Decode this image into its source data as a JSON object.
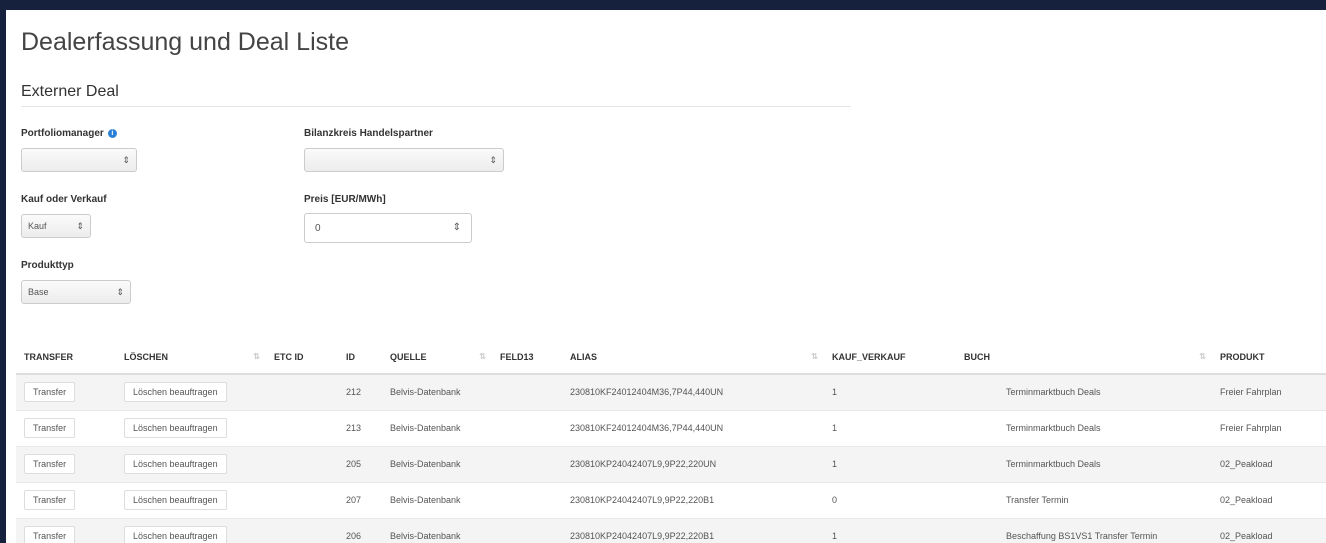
{
  "page": {
    "title": "Dealerfassung und Deal Liste",
    "section_title": "Externer Deal"
  },
  "form": {
    "portfoliomanager": {
      "label": "Portfoliomanager",
      "value": "",
      "info_icon": "info-icon"
    },
    "bilanzkreis": {
      "label": "Bilanzkreis Handelspartner",
      "value": ""
    },
    "kauf_verkauf": {
      "label": "Kauf oder Verkauf",
      "value": "Kauf"
    },
    "preis": {
      "label": "Preis [EUR/MWh]",
      "value": "0"
    },
    "produkttyp": {
      "label": "Produkttyp",
      "value": "Base"
    }
  },
  "table": {
    "columns": [
      "TRANSFER",
      "LÖSCHEN",
      "ETC ID",
      "ID",
      "QUELLE",
      "FELD13",
      "ALIAS",
      "KAUF_VERKAUF",
      "BUCH",
      "PRODUKT"
    ],
    "rows": [
      {
        "transfer": "Transfer",
        "loeschen": "Löschen beauftragen",
        "etc_id": "",
        "id": "212",
        "quelle": "Belvis-Datenbank",
        "feld13": "",
        "alias": "230810KF24012404M36,7P44,440UN",
        "kauf_verkauf": "1",
        "buch": "Terminmarktbuch Deals",
        "produkt": "Freier Fahrplan"
      },
      {
        "transfer": "Transfer",
        "loeschen": "Löschen beauftragen",
        "etc_id": "",
        "id": "213",
        "quelle": "Belvis-Datenbank",
        "feld13": "",
        "alias": "230810KF24012404M36,7P44,440UN",
        "kauf_verkauf": "1",
        "buch": "Terminmarktbuch Deals",
        "produkt": "Freier Fahrplan"
      },
      {
        "transfer": "Transfer",
        "loeschen": "Löschen beauftragen",
        "etc_id": "",
        "id": "205",
        "quelle": "Belvis-Datenbank",
        "feld13": "",
        "alias": "230810KP24042407L9,9P22,220UN",
        "kauf_verkauf": "1",
        "buch": "Terminmarktbuch Deals",
        "produkt": "02_Peakload"
      },
      {
        "transfer": "Transfer",
        "loeschen": "Löschen beauftragen",
        "etc_id": "",
        "id": "207",
        "quelle": "Belvis-Datenbank",
        "feld13": "",
        "alias": "230810KP24042407L9,9P22,220B1",
        "kauf_verkauf": "0",
        "buch": "Transfer Termin",
        "produkt": "02_Peakload"
      },
      {
        "transfer": "Transfer",
        "loeschen": "Löschen beauftragen",
        "etc_id": "",
        "id": "206",
        "quelle": "Belvis-Datenbank",
        "feld13": "",
        "alias": "230810KP24042407L9,9P22,220B1",
        "kauf_verkauf": "1",
        "buch": "Beschaffung BS1VS1 Transfer Termin",
        "produkt": "02_Peakload"
      }
    ]
  }
}
